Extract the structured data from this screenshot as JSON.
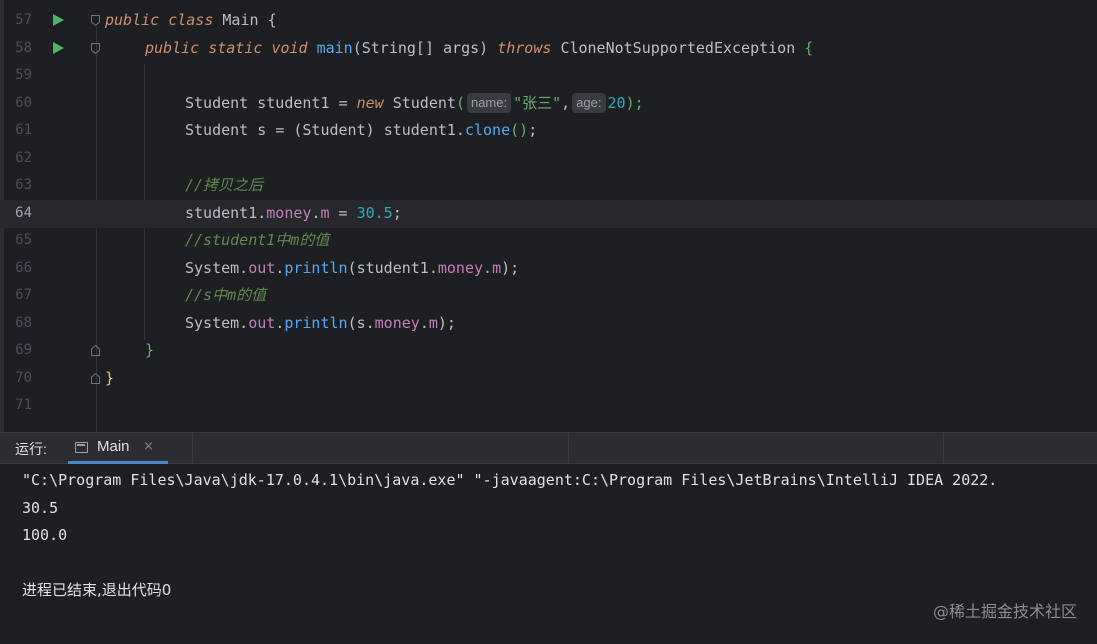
{
  "editor": {
    "lines": [
      {
        "num": "57",
        "run": true,
        "fold": "open"
      },
      {
        "num": "58",
        "run": true,
        "fold": "open"
      },
      {
        "num": "59"
      },
      {
        "num": "60"
      },
      {
        "num": "61"
      },
      {
        "num": "62"
      },
      {
        "num": "63"
      },
      {
        "num": "64",
        "current": true
      },
      {
        "num": "65"
      },
      {
        "num": "66"
      },
      {
        "num": "67"
      },
      {
        "num": "68"
      },
      {
        "num": "69",
        "fold": "close"
      },
      {
        "num": "70",
        "fold": "close"
      },
      {
        "num": "71"
      }
    ],
    "code": {
      "l57": {
        "kw_public": "public",
        "kw_class": "class",
        "name": "Main",
        "brace": "{"
      },
      "l58": {
        "kw_public": "public",
        "kw_static": "static",
        "kw_void": "void",
        "fn": "main",
        "open": "(",
        "type": "String[]",
        "param": "args",
        "close": ")",
        "kw_throws": "throws",
        "exc": "CloneNotSupportedException",
        "brace": "{"
      },
      "l60": {
        "type": "Student",
        "var": "student1",
        "eq": "=",
        "kw_new": "new",
        "ctor": "Student",
        "open": "(",
        "hint_name": "name:",
        "str": "\"张三\"",
        "comma": ",",
        "hint_age": "age:",
        "num": "20",
        "close": ");"
      },
      "l61": {
        "type": "Student",
        "var": "s",
        "eq": "=",
        "cast": "(Student)",
        "obj": "student1.",
        "fn": "clone",
        "parens": "()",
        "semi": ";"
      },
      "l63": {
        "comment": "//拷贝之后"
      },
      "l64": {
        "obj": "student1.",
        "fld": "money",
        "dot": ".",
        "fld2": "m",
        "eq": "=",
        "num": "30.5",
        "semi": ";"
      },
      "l65": {
        "comment": "//student1中m的值"
      },
      "l66": {
        "cls": "System.",
        "fld": "out",
        "dot": ".",
        "fn": "println",
        "open": "(",
        "obj": "student1.",
        "fld2": "money",
        "dot2": ".",
        "fld3": "m",
        "close": ");"
      },
      "l67": {
        "comment": "//s中m的值"
      },
      "l68": {
        "cls": "System.",
        "fld": "out",
        "dot": ".",
        "fn": "println",
        "open": "(",
        "obj": "s.",
        "fld2": "money",
        "dot2": ".",
        "fld3": "m",
        "close": ");"
      },
      "l69": {
        "brace": "}"
      },
      "l70": {
        "brace": "}"
      }
    }
  },
  "run_panel": {
    "label": "运行:",
    "tab": {
      "name": "Main",
      "close": "×"
    },
    "output": [
      "\"C:\\Program Files\\Java\\jdk-17.0.4.1\\bin\\java.exe\" \"-javaagent:C:\\Program Files\\JetBrains\\IntelliJ IDEA 2022.",
      "30.5",
      "100.0",
      "",
      "进程已结束,退出代码0"
    ]
  },
  "watermark": "@稀土掘金技术社区",
  "colors": {
    "background": "#1e1f22",
    "keyword": "#cf8e6d",
    "field": "#c77dbb",
    "function": "#56a8f5",
    "number": "#2aacb8",
    "string": "#6aab73",
    "run_icon": "#4fb368",
    "tab_underline": "#4a88c7"
  }
}
